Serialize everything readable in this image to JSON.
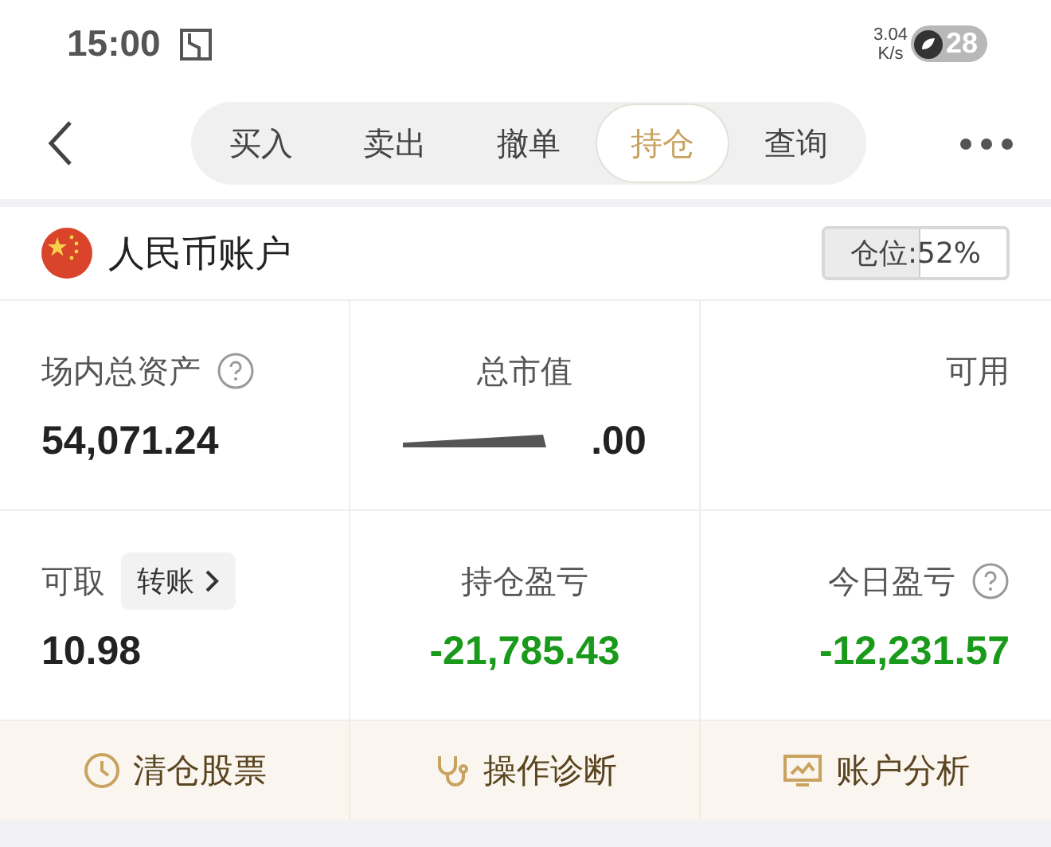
{
  "status_bar": {
    "time": "15:00",
    "speed_value": "3.04",
    "speed_unit": "K/s",
    "battery": "28"
  },
  "tabs": [
    {
      "label": "买入",
      "selected": false
    },
    {
      "label": "卖出",
      "selected": false
    },
    {
      "label": "撤单",
      "selected": false
    },
    {
      "label": "持仓",
      "selected": true
    },
    {
      "label": "查询",
      "selected": false
    }
  ],
  "account": {
    "name": "人民币账户",
    "position_label": "仓位:52%",
    "level": 0.52
  },
  "cells": [
    {
      "label": "场内总资产",
      "help": true,
      "value": "54,071.24",
      "kind": "plain"
    },
    {
      "label": "总市值",
      "value": ".00",
      "redacted": true,
      "kind": "plain"
    },
    {
      "label": "可用"
    },
    {
      "label": "可取",
      "action": "转账",
      "value": "10.98",
      "kind": "plain"
    },
    {
      "label": "持仓盈亏",
      "value": "-21,785.43",
      "kind": "loss"
    },
    {
      "label": "今日盈亏",
      "help": true,
      "value": "-12,231.57",
      "kind": "loss"
    }
  ],
  "actions": [
    {
      "label": "清仓股票",
      "kind": "clock"
    },
    {
      "label": "操作诊断",
      "kind": "stethoscope"
    },
    {
      "label": "账户分析",
      "kind": "monitor"
    }
  ]
}
